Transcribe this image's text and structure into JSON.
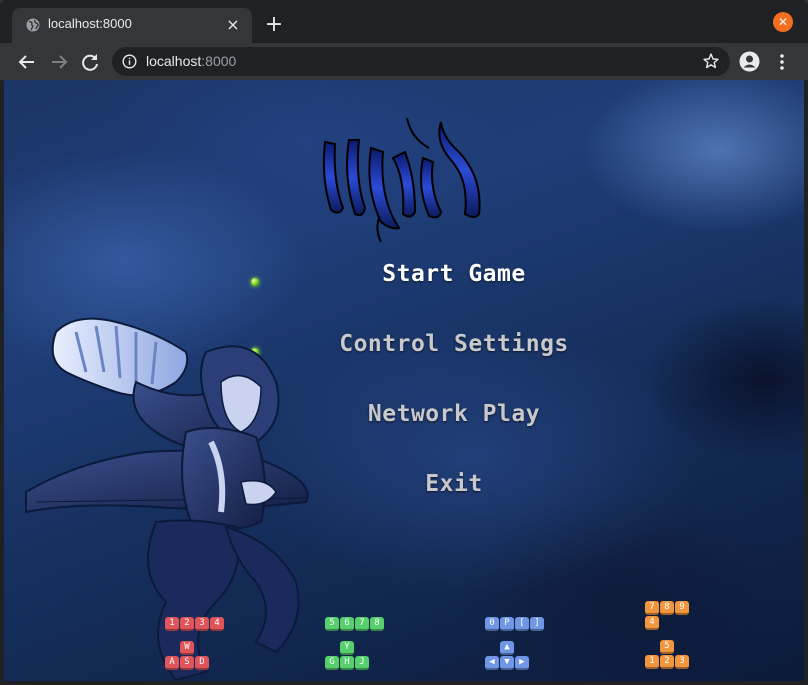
{
  "browser": {
    "tab_title": "localhost:8000",
    "tab_close_glyph": "×",
    "new_tab_glyph": "+",
    "window_close_glyph": "✕",
    "url_host": "localhost",
    "url_port": ":8000",
    "icons": [
      "globe-icon",
      "close-icon",
      "plus-icon",
      "back-arrow-icon",
      "forward-arrow-icon",
      "reload-icon",
      "info-icon",
      "star-icon",
      "profile-icon",
      "kebab-menu-icon"
    ]
  },
  "game": {
    "menu": [
      {
        "label": "Start Game",
        "state": "active"
      },
      {
        "label": "Control Settings",
        "state": "idle"
      },
      {
        "label": "Network Play",
        "state": "idle"
      },
      {
        "label": "Exit",
        "state": "idle"
      }
    ],
    "colors": {
      "active_text": "#ffffff",
      "idle_text": "#c9c9cc",
      "player1": "#e0555a",
      "player2": "#56cf6d",
      "player3": "#6f97e6",
      "player4": "#f0963f"
    },
    "key_hints": {
      "player1": {
        "top": [
          "1",
          "2",
          "3",
          "4"
        ],
        "up": "W",
        "bottom": [
          "A",
          "S",
          "D"
        ]
      },
      "player2": {
        "top": [
          "5",
          "6",
          "7",
          "8"
        ],
        "up": "Y",
        "bottom": [
          "G",
          "H",
          "J"
        ]
      },
      "player3": {
        "top": [
          "0",
          "P",
          "[",
          "]"
        ],
        "up": "▲",
        "bottom": [
          "◀",
          "▼",
          "▶"
        ]
      },
      "player4": {
        "top": [
          "7",
          "8",
          "9"
        ],
        "top2": "4",
        "up": "5",
        "bottom": [
          "1",
          "2",
          "3"
        ]
      }
    }
  }
}
